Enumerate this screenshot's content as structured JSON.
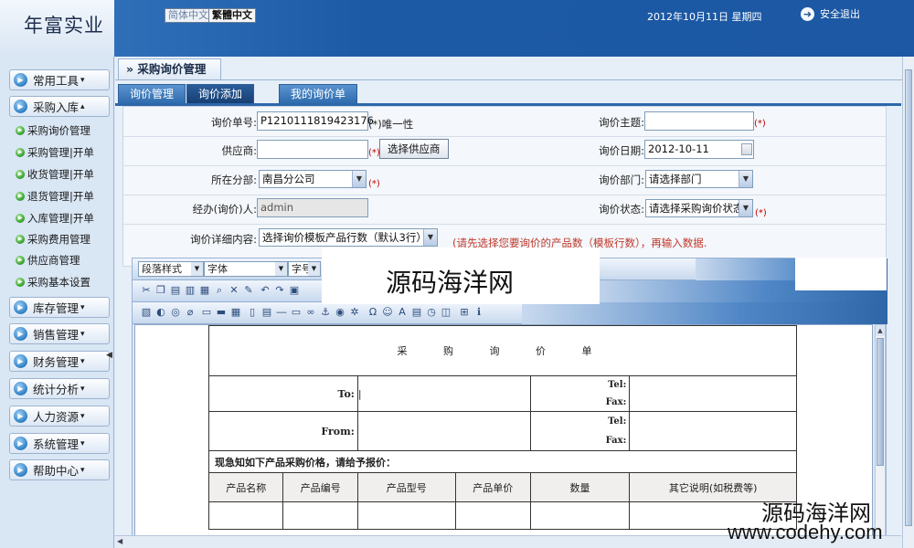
{
  "header": {
    "logo": "年富实业",
    "lang_simplified": "简体中文",
    "lang_traditional": "繁體中文",
    "date": "2012年10月11日 星期四",
    "logout": "安全退出"
  },
  "sidebar": {
    "groups": [
      {
        "label": "常用工具",
        "caret": "▾"
      },
      {
        "label": "采购入库",
        "caret": "▴"
      },
      {
        "label": "库存管理",
        "caret": "▾"
      },
      {
        "label": "销售管理",
        "caret": "▾"
      },
      {
        "label": "财务管理",
        "caret": "▾"
      },
      {
        "label": "统计分析",
        "caret": "▾"
      },
      {
        "label": "人力资源",
        "caret": "▾"
      },
      {
        "label": "系统管理",
        "caret": "▾"
      },
      {
        "label": "帮助中心",
        "caret": "▾"
      }
    ],
    "subitems": [
      "采购询价管理",
      "采购管理|开单",
      "收货管理|开单",
      "退货管理|开单",
      "入库管理|开单",
      "采购费用管理",
      "供应商管理",
      "采购基本设置"
    ]
  },
  "page": {
    "title": "» 采购询价管理",
    "tabs": [
      "询价管理",
      "询价添加",
      "我的询价单"
    ]
  },
  "form": {
    "inquiry_no_label": "询价单号:",
    "inquiry_no": "P1210111819423176",
    "inquiry_no_note": "(*)唯一性",
    "subject_label": "询价主题:",
    "subject_value": "",
    "required_mark": "(*)",
    "supplier_label": "供应商:",
    "supplier_value": "",
    "select_supplier_btn": "选择供应商",
    "date_label": "询价日期:",
    "date_value": "2012-10-11",
    "branch_label": "所在分部:",
    "branch_value": "南昌分公司",
    "dept_label": "询价部门:",
    "dept_value": "请选择部门",
    "handler_label": "经办(询价)人:",
    "handler_value": "admin",
    "status_label": "询价状态:",
    "status_value": "请选择采购询价状态",
    "detail_label": "询价详细内容:",
    "detail_value": "选择询价模板产品行数（默认3行）",
    "detail_warning": "(请先选择您要询价的产品数（模板行数），再输入数据."
  },
  "editor": {
    "paragraph_style": "段落样式",
    "font": "字体",
    "font_size": "字号",
    "sheet": {
      "title": "采 购 询 价 单",
      "to_label": "To:",
      "from_label": "From:",
      "tel_label": "Tel:",
      "fax_label": "Fax:",
      "notice": "现急知如下产品采购价格，请给予报价：",
      "columns": [
        "产品名称",
        "产品编号",
        "产品型号",
        "产品单价",
        "数量",
        "其它说明(如税费等)"
      ]
    }
  },
  "watermarks": {
    "center": "源码海洋网",
    "corner_cn": "源码海洋网",
    "corner_url": "www.codehy.com"
  }
}
